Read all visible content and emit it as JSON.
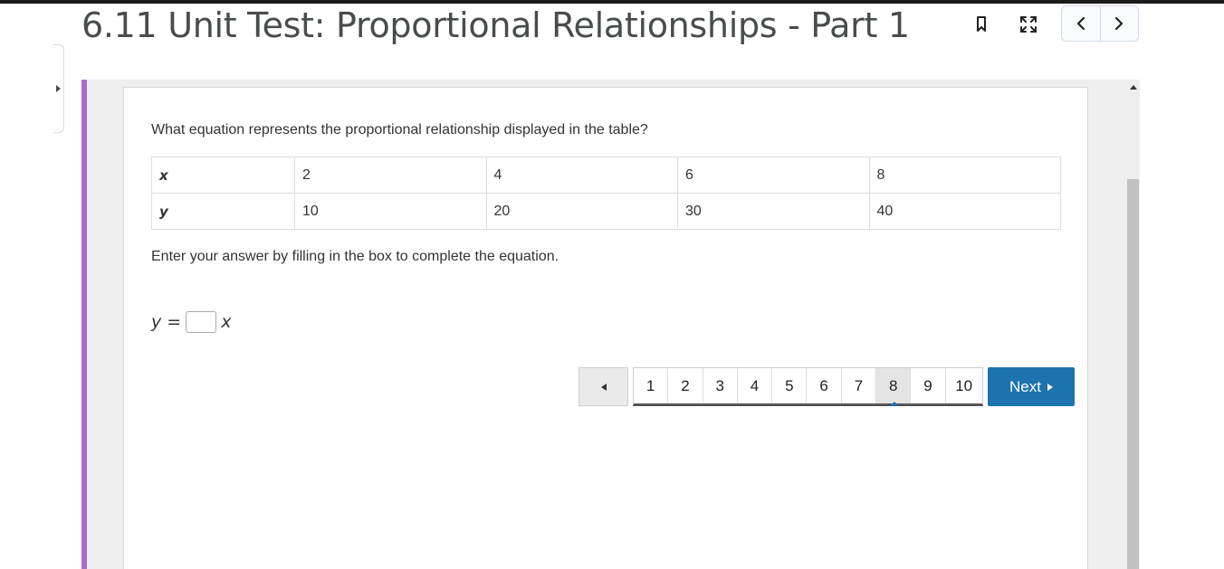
{
  "header": {
    "title": "6.11 Unit Test: Proportional Relationships - Part 1",
    "icons": [
      "bookmark-icon",
      "fullscreen-icon",
      "chevron-left-icon",
      "chevron-right-icon"
    ]
  },
  "question": {
    "prompt": "What equation represents the proportional relationship displayed in the table?",
    "table": {
      "rows": [
        {
          "label": "x",
          "values": [
            "2",
            "4",
            "6",
            "8"
          ]
        },
        {
          "label": "y",
          "values": [
            "10",
            "20",
            "30",
            "40"
          ]
        }
      ]
    },
    "instruction": "Enter your answer by filling in the box to complete the equation.",
    "equation": {
      "lhs": "y =",
      "rhs": "x",
      "answer_value": ""
    }
  },
  "pager": {
    "pages": [
      "1",
      "2",
      "3",
      "4",
      "5",
      "6",
      "7",
      "8",
      "9",
      "10"
    ],
    "current": "8",
    "next_label": "Next"
  },
  "colors": {
    "accent": "#a96ecb",
    "next_button": "#1c73ae"
  }
}
